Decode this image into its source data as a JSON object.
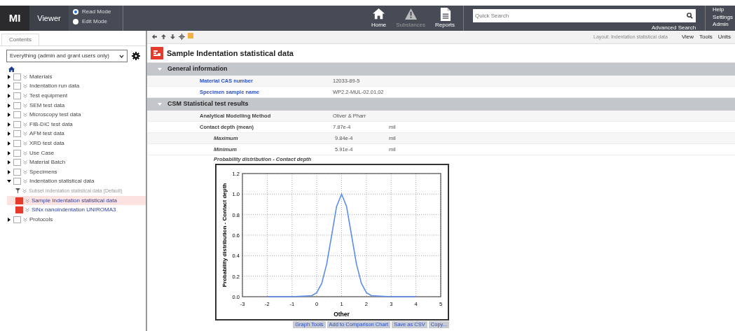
{
  "header": {
    "logo": "MI",
    "app": "Viewer",
    "modes": [
      {
        "label": "Read Mode",
        "selected": true
      },
      {
        "label": "Edit Mode",
        "selected": false
      }
    ],
    "nav": [
      {
        "label": "Home",
        "kind": "home",
        "disabled": false
      },
      {
        "label": "Substances",
        "kind": "warning",
        "disabled": true
      },
      {
        "label": "Reports",
        "kind": "report",
        "disabled": false
      }
    ],
    "search": {
      "placeholder": "Quick Search",
      "advanced": "Advanced Search"
    },
    "links": [
      "Help",
      "Settings",
      "Admin"
    ]
  },
  "sidebar": {
    "tab": "Contents",
    "filter": "Everything (admin and grant users only)",
    "tree": [
      {
        "label": "Materials",
        "kind": "table",
        "expanded": false
      },
      {
        "label": "Indentation run data",
        "kind": "table",
        "expanded": false
      },
      {
        "label": "Test equipment",
        "kind": "table",
        "expanded": false
      },
      {
        "label": "SEM test data",
        "kind": "table",
        "expanded": false
      },
      {
        "label": "Microscopy test data",
        "kind": "table",
        "expanded": false
      },
      {
        "label": "FIB-DIC test data",
        "kind": "table",
        "expanded": false
      },
      {
        "label": "AFM test data",
        "kind": "table",
        "expanded": false
      },
      {
        "label": "XRD test data",
        "kind": "table",
        "expanded": false
      },
      {
        "label": "Use Case",
        "kind": "table",
        "expanded": false
      },
      {
        "label": "Material Batch",
        "kind": "table",
        "expanded": false
      },
      {
        "label": "Specimens",
        "kind": "table",
        "expanded": false
      },
      {
        "label": "Indentation statistical data",
        "kind": "table",
        "expanded": true,
        "children": [
          {
            "label": "Subset Indentation statistical data (Default)",
            "kind": "filter",
            "selected": false
          },
          {
            "label": "Sample Indentation statistical data",
            "kind": "record",
            "selected": true
          },
          {
            "label": "SiNx nanoindentation UNIROMA3",
            "kind": "record",
            "selected": false
          }
        ]
      },
      {
        "label": "Protocols",
        "kind": "table",
        "expanded": false
      }
    ]
  },
  "toolbar": {
    "layout": "Layout: Indentation statistical data",
    "menus": [
      "View",
      "Tools",
      "Units"
    ]
  },
  "record": {
    "title": "Sample Indentation statistical data",
    "sections": [
      {
        "title": "General information",
        "rows": [
          {
            "kind": "link",
            "label": "Material CAS number",
            "value": "12033-89-5"
          },
          {
            "kind": "link",
            "label": "Specimen sample name",
            "value": "WP2.2-MUL-02.01,02"
          }
        ]
      },
      {
        "title": "CSM Statistical test results",
        "rows": [
          {
            "kind": "plain",
            "label": "Analytical Modelling Method",
            "value": "Oliver & Pharr"
          },
          {
            "kind": "plain",
            "label": "Contact depth (mean)",
            "value": "7.87e-4",
            "unit": "mil"
          },
          {
            "kind": "sub",
            "label": "Maximum",
            "value": "9.84e-4",
            "unit": "mil"
          },
          {
            "kind": "sub",
            "label": "Minimum",
            "value": "5.91e-4",
            "unit": "mil"
          }
        ]
      }
    ],
    "graph": {
      "title": "Probability distribution - Contact depth",
      "chart_data": {
        "type": "line",
        "xlabel": "Other",
        "ylabel": "Probability distribution - Contact depth",
        "x": [
          -2,
          -1,
          -0.2,
          0,
          0.2,
          0.4,
          0.6,
          0.8,
          1,
          1.2,
          1.4,
          1.6,
          1.8,
          2,
          2.2,
          3,
          4
        ],
        "grid": true,
        "series": [
          {
            "color": "#5b8def",
            "values": [
              0,
              0,
              0.01,
              0.04,
              0.13,
              0.32,
              0.6,
              0.88,
              1.0,
              0.88,
              0.6,
              0.32,
              0.13,
              0.04,
              0.01,
              0,
              0
            ]
          }
        ],
        "xlim": [
          -3,
          5
        ],
        "ylim": [
          0,
          1.2
        ],
        "xticks": [
          -3,
          -2,
          -1,
          0,
          1,
          2,
          3,
          4,
          5
        ],
        "yticks": [
          {
            "value": 0,
            "label": "0.0"
          },
          {
            "value": 0.2,
            "label": "0.2"
          },
          {
            "value": 0.4,
            "label": "0.4"
          },
          {
            "value": 0.6,
            "label": "0.6"
          },
          {
            "value": 0.8,
            "label": "0.8"
          },
          {
            "value": 1,
            "label": "1.0"
          },
          {
            "value": 1.2,
            "label": "1.2"
          }
        ]
      },
      "buttons": [
        "Graph Tools",
        "Add to Comparison Chart",
        "Save as CSV",
        "Copy..."
      ]
    }
  }
}
